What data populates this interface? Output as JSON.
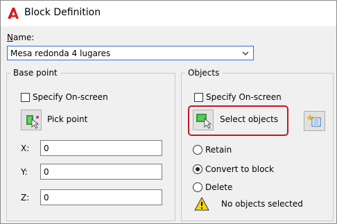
{
  "window": {
    "title": "Block Definition"
  },
  "name": {
    "label": "Name:",
    "value": "Mesa redonda 4 lugares"
  },
  "base_point": {
    "title": "Base point",
    "specify_label": "Specify On-screen",
    "pick_label": "Pick point",
    "x_label": "X:",
    "x_value": "0",
    "y_label": "Y:",
    "y_value": "0",
    "z_label": "Z:",
    "z_value": "0"
  },
  "objects": {
    "title": "Objects",
    "specify_label": "Specify On-screen",
    "select_label": "Select objects",
    "retain_label": "Retain",
    "convert_label": "Convert to block",
    "delete_label": "Delete",
    "status_text": "No objects selected",
    "selected_option": "Convert to block"
  },
  "colors": {
    "highlight": "#c51523",
    "warning": "#f5d90a",
    "focus": "#2f6fd1"
  }
}
